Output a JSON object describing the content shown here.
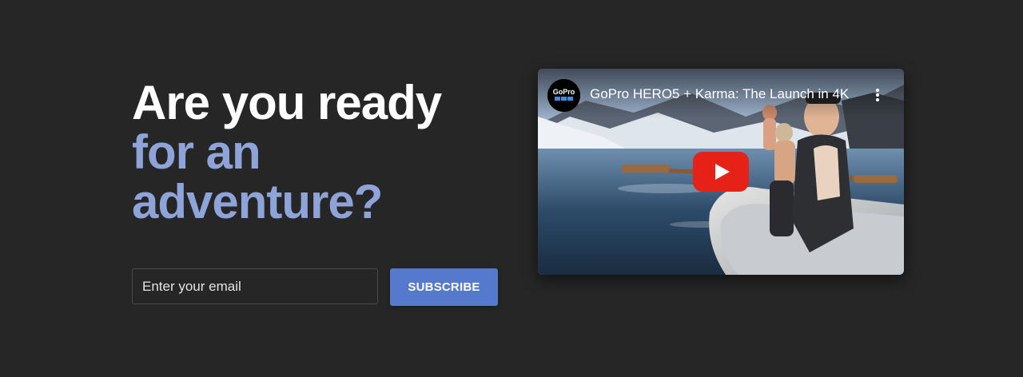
{
  "hero": {
    "line1": "Are you ready",
    "line2": "for an",
    "line3": "adventure?"
  },
  "signup": {
    "email_placeholder": "Enter your email",
    "subscribe_label": "SUBSCRIBE"
  },
  "video": {
    "title": "GoPro HERO5 + Karma: The Launch in 4K",
    "channel_logo_text": "GoPro",
    "play_icon": "youtube-play-icon",
    "menu_icon": "more-vertical-icon"
  },
  "colors": {
    "background": "#262626",
    "headline_white": "#ffffff",
    "headline_accent": "#8ea3d7",
    "button_blue": "#5579cd",
    "play_red": "#e62117"
  }
}
